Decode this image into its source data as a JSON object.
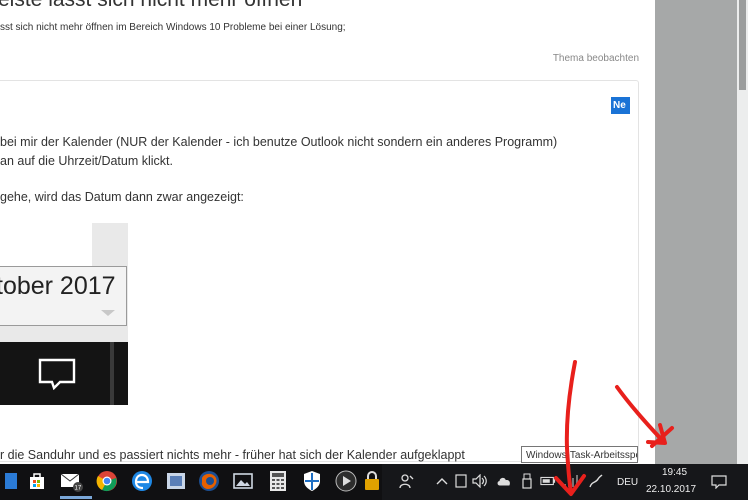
{
  "page": {
    "title": "eiste lässt sich nicht mehr öffnen",
    "breadcrumb": "sst sich nicht mehr öffnen im Bereich Windows 10 Probleme bei einer Lösung;",
    "watch_label": "Thema beobachten"
  },
  "post": {
    "new_badge": "Ne",
    "lines": [
      "bei mir der Kalender (NUR der Kalender - ich benutze Outlook nicht sondern ein anderes Programm)",
      "an auf die Uhrzeit/Datum klickt.",
      "gehe, wird das Datum dann zwar angezeigt:"
    ],
    "embedded_calendar_text": "tober 2017",
    "bottom_line": "r die Sanduhr und es passiert nichts mehr - früher hat sich der Kalender aufgeklappt",
    "tooltip": "Windows-Task-Arbeitsspeicher"
  },
  "taskbar": {
    "language": "DEU",
    "time": "19:45",
    "date": "22.10.2017",
    "badge_count": "17",
    "pinned_icons": [
      "store-icon",
      "mail-icon",
      "chrome-icon",
      "edge-icon",
      "mail-alt-icon",
      "firefox-icon",
      "photos-icon",
      "calculator-icon",
      "defender-icon",
      "media-icon",
      "lock-icon"
    ],
    "tray_icons": [
      "people-icon",
      "chevron-up-icon",
      "tablet-icon",
      "volume-icon",
      "onedrive-icon",
      "usb-icon",
      "battery-icon",
      "network-icon",
      "pen-icon"
    ]
  },
  "colors": {
    "annotation_red": "#e8201c",
    "accent_blue": "#1a73d6"
  }
}
